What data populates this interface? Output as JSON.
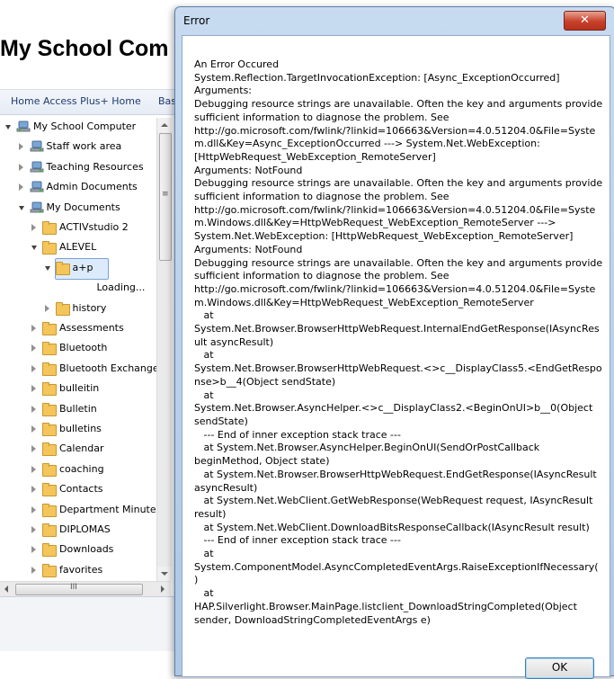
{
  "app": {
    "title": "My School Com"
  },
  "navbar": {
    "home": "Home Access Plus+ Home",
    "next": "Bas"
  },
  "tree": {
    "items": [
      {
        "label": "My School Computer",
        "icon": "computer-icon",
        "state": "expanded"
      },
      {
        "label": "Staff work area",
        "icon": "network-drive-icon",
        "state": "collapsed"
      },
      {
        "label": "Teaching Resources",
        "icon": "network-drive-icon",
        "state": "collapsed"
      },
      {
        "label": "Admin Documents",
        "icon": "network-drive-icon",
        "state": "collapsed"
      },
      {
        "label": "My Documents",
        "icon": "network-drive-icon",
        "state": "expanded"
      },
      {
        "label": "ACTIVstudio 2",
        "icon": "folder-icon",
        "state": "collapsed"
      },
      {
        "label": "ALEVEL",
        "icon": "folder-icon",
        "state": "expanded"
      },
      {
        "label": "a+p",
        "icon": "folder-icon",
        "state": "expanded",
        "selected": true
      },
      {
        "label": "Loading...",
        "icon": "",
        "state": "none"
      },
      {
        "label": "history",
        "icon": "folder-icon",
        "state": "collapsed"
      },
      {
        "label": "Assessments",
        "icon": "folder-icon",
        "state": "collapsed"
      },
      {
        "label": "Bluetooth",
        "icon": "folder-icon",
        "state": "collapsed"
      },
      {
        "label": "Bluetooth Exchange",
        "icon": "folder-icon",
        "state": "collapsed"
      },
      {
        "label": "bulleitin",
        "icon": "folder-icon",
        "state": "collapsed"
      },
      {
        "label": "Bulletin",
        "icon": "folder-icon",
        "state": "collapsed"
      },
      {
        "label": "bulletins",
        "icon": "folder-icon",
        "state": "collapsed"
      },
      {
        "label": "Calendar",
        "icon": "folder-icon",
        "state": "collapsed"
      },
      {
        "label": "coaching",
        "icon": "folder-icon",
        "state": "collapsed"
      },
      {
        "label": "Contacts",
        "icon": "folder-icon",
        "state": "collapsed"
      },
      {
        "label": "Department Minute",
        "icon": "folder-icon",
        "state": "collapsed"
      },
      {
        "label": "DIPLOMAS",
        "icon": "folder-icon",
        "state": "collapsed"
      },
      {
        "label": "Downloads",
        "icon": "folder-icon",
        "state": "collapsed"
      },
      {
        "label": "favorites",
        "icon": "folder-icon",
        "state": "collapsed"
      }
    ]
  },
  "dialog": {
    "title": "Error",
    "close_glyph": "✕",
    "ok_label": "OK",
    "message": "An Error Occured\nSystem.Reflection.TargetInvocationException: [Async_ExceptionOccurred]\nArguments:\nDebugging resource strings are unavailable. Often the key and arguments provide\nsufficient information to diagnose the problem. See\nhttp://go.microsoft.com/fwlink/?linkid=106663&Version=4.0.51204.0&File=Syste\nm.dll&Key=Async_ExceptionOccurred ---> System.Net.WebException:\n[HttpWebRequest_WebException_RemoteServer]\nArguments: NotFound\nDebugging resource strings are unavailable. Often the key and arguments provide\nsufficient information to diagnose the problem. See\nhttp://go.microsoft.com/fwlink/?linkid=106663&Version=4.0.51204.0&File=Syste\nm.Windows.dll&Key=HttpWebRequest_WebException_RemoteServer --->\nSystem.Net.WebException: [HttpWebRequest_WebException_RemoteServer]\nArguments: NotFound\nDebugging resource strings are unavailable. Often the key and arguments provide\nsufficient information to diagnose the problem. See\nhttp://go.microsoft.com/fwlink/?linkid=106663&Version=4.0.51204.0&File=Syste\nm.Windows.dll&Key=HttpWebRequest_WebException_RemoteServer\n   at\nSystem.Net.Browser.BrowserHttpWebRequest.InternalEndGetResponse(IAsyncRes\nult asyncResult)\n   at\nSystem.Net.Browser.BrowserHttpWebRequest.<>c__DisplayClass5.<EndGetRespo\nnse>b__4(Object sendState)\n   at\nSystem.Net.Browser.AsyncHelper.<>c__DisplayClass2.<BeginOnUI>b__0(Object\nsendState)\n   --- End of inner exception stack trace ---\n   at System.Net.Browser.AsyncHelper.BeginOnUI(SendOrPostCallback\nbeginMethod, Object state)\n   at System.Net.Browser.BrowserHttpWebRequest.EndGetResponse(IAsyncResult\nasyncResult)\n   at System.Net.WebClient.GetWebResponse(WebRequest request, IAsyncResult\nresult)\n   at System.Net.WebClient.DownloadBitsResponseCallback(IAsyncResult result)\n   --- End of inner exception stack trace ---\n   at\nSystem.ComponentModel.AsyncCompletedEventArgs.RaiseExceptionIfNecessary(\n)\n   at\nHAP.Silverlight.Browser.MainPage.listclient_DownloadStringCompleted(Object\nsender, DownloadStringCompletedEventArgs e)"
  },
  "scroll": {
    "hthumb_glyph": "III",
    "vthumb_glyph": "≡"
  }
}
